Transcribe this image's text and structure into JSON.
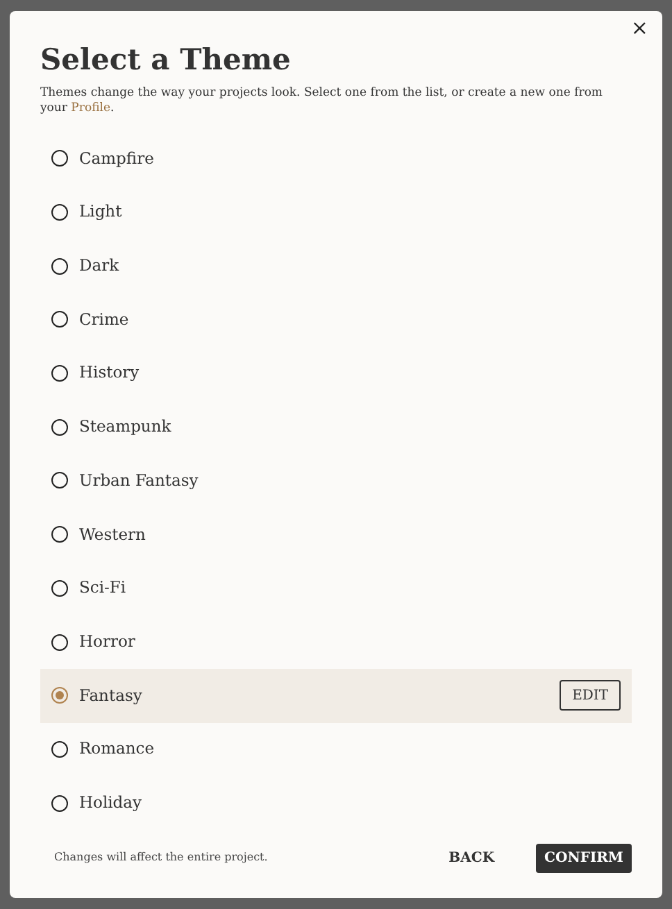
{
  "dialog": {
    "close": "×",
    "title": "Select a Theme",
    "description": "Themes change the way your projects look. Select one from the list, or create a new one from your ",
    "link": "Profile",
    "description_end": "."
  },
  "themes": [
    {
      "label": "Campfire",
      "selected": false
    },
    {
      "label": "Light",
      "selected": false
    },
    {
      "label": "Dark",
      "selected": false
    },
    {
      "label": "Crime",
      "selected": false
    },
    {
      "label": "History",
      "selected": false
    },
    {
      "label": "Steampunk",
      "selected": false
    },
    {
      "label": "Urban Fantasy",
      "selected": false
    },
    {
      "label": "Western",
      "selected": false
    },
    {
      "label": "Sci-Fi",
      "selected": false
    },
    {
      "label": "Horror",
      "selected": false
    },
    {
      "label": "Fantasy",
      "selected": true,
      "action": "EDIT"
    },
    {
      "label": "Romance",
      "selected": false
    },
    {
      "label": "Holiday",
      "selected": false
    }
  ],
  "footer": {
    "note": "Changes will affect the entire project.",
    "back": "BACK",
    "confirm": "CONFIRM"
  }
}
